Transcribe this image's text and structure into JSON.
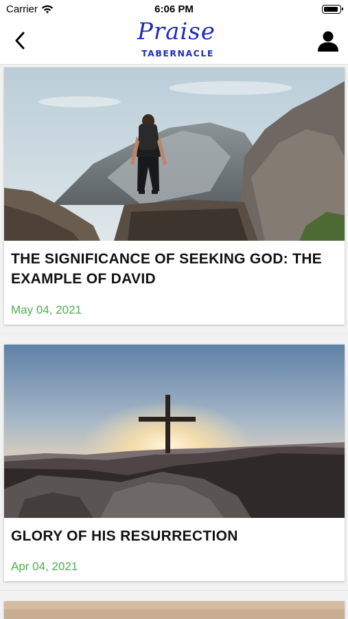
{
  "status_bar": {
    "carrier": "Carrier",
    "time": "6:06 PM"
  },
  "header": {
    "logo_script": "Praise",
    "logo_sub": "TABERNACLE",
    "brand_color": "#1f2db5"
  },
  "posts": [
    {
      "title": "THE SIGNIFICANCE OF SEEKING GOD: THE EXAMPLE OF DAVID",
      "date": "May 04, 2021"
    },
    {
      "title": "GLORY OF HIS RESURRECTION",
      "date": "Apr 04, 2021"
    }
  ],
  "colors": {
    "date_green": "#4caf50",
    "title": "#111111"
  }
}
